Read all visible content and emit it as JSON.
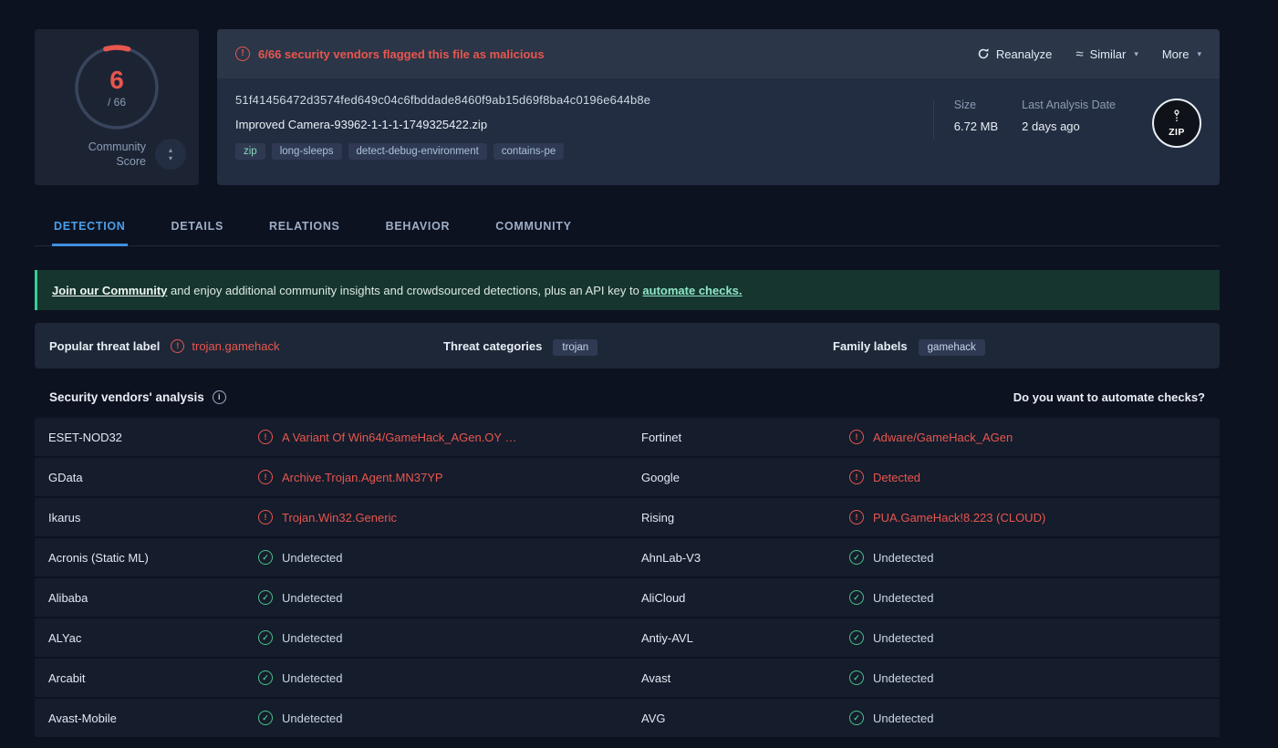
{
  "score_card": {
    "score": "6",
    "total": "/ 66",
    "community_label": "Community Score",
    "detections": 6,
    "total_engines": 66,
    "accent_color": "#e8564f"
  },
  "header": {
    "warning": "6/66 security vendors flagged this file as malicious",
    "actions": {
      "reanalyze": "Reanalyze",
      "similar": "Similar",
      "more": "More"
    },
    "hash": "51f41456472d3574fed649c04c6fbddade8460f9ab15d69f8ba4c0196e644b8e",
    "filename": "Improved Camera-93962-1-1-1-1749325422.zip",
    "tags": [
      {
        "label": "zip",
        "accent": true
      },
      {
        "label": "long-sleeps",
        "accent": false
      },
      {
        "label": "detect-debug-environment",
        "accent": false
      },
      {
        "label": "contains-pe",
        "accent": false
      }
    ],
    "size_label": "Size",
    "size_value": "6.72 MB",
    "date_label": "Last Analysis Date",
    "date_value": "2 days ago",
    "file_type": "ZIP"
  },
  "tabs": [
    {
      "label": "DETECTION",
      "active": true
    },
    {
      "label": "DETAILS",
      "active": false
    },
    {
      "label": "RELATIONS",
      "active": false
    },
    {
      "label": "BEHAVIOR",
      "active": false
    },
    {
      "label": "COMMUNITY",
      "active": false
    }
  ],
  "banner": {
    "link_community": "Join our Community",
    "middle": " and enjoy additional community insights and crowdsourced detections, plus an API key to ",
    "link_automate": "automate checks."
  },
  "threat": {
    "popular_label": "Popular threat label",
    "popular_value": "trojan.gamehack",
    "categories_label": "Threat categories",
    "categories": [
      "trojan"
    ],
    "family_label": "Family labels",
    "families": [
      "gamehack"
    ]
  },
  "analysis": {
    "title": "Security vendors' analysis",
    "automate_question": "Do you want to automate checks?"
  },
  "vendors": [
    {
      "left": {
        "name": "ESET-NOD32",
        "result": "A Variant Of Win64/GameHack_AGen.OY …",
        "status": "flagged"
      },
      "right": {
        "name": "Fortinet",
        "result": "Adware/GameHack_AGen",
        "status": "flagged"
      }
    },
    {
      "left": {
        "name": "GData",
        "result": "Archive.Trojan.Agent.MN37YP",
        "status": "flagged"
      },
      "right": {
        "name": "Google",
        "result": "Detected",
        "status": "flagged"
      }
    },
    {
      "left": {
        "name": "Ikarus",
        "result": "Trojan.Win32.Generic",
        "status": "flagged"
      },
      "right": {
        "name": "Rising",
        "result": "PUA.GameHack!8.223 (CLOUD)",
        "status": "flagged"
      }
    },
    {
      "left": {
        "name": "Acronis (Static ML)",
        "result": "Undetected",
        "status": "undetected"
      },
      "right": {
        "name": "AhnLab-V3",
        "result": "Undetected",
        "status": "undetected"
      }
    },
    {
      "left": {
        "name": "Alibaba",
        "result": "Undetected",
        "status": "undetected"
      },
      "right": {
        "name": "AliCloud",
        "result": "Undetected",
        "status": "undetected"
      }
    },
    {
      "left": {
        "name": "ALYac",
        "result": "Undetected",
        "status": "undetected"
      },
      "right": {
        "name": "Antiy-AVL",
        "result": "Undetected",
        "status": "undetected"
      }
    },
    {
      "left": {
        "name": "Arcabit",
        "result": "Undetected",
        "status": "undetected"
      },
      "right": {
        "name": "Avast",
        "result": "Undetected",
        "status": "undetected"
      }
    },
    {
      "left": {
        "name": "Avast-Mobile",
        "result": "Undetected",
        "status": "undetected"
      },
      "right": {
        "name": "AVG",
        "result": "Undetected",
        "status": "undetected"
      }
    }
  ]
}
